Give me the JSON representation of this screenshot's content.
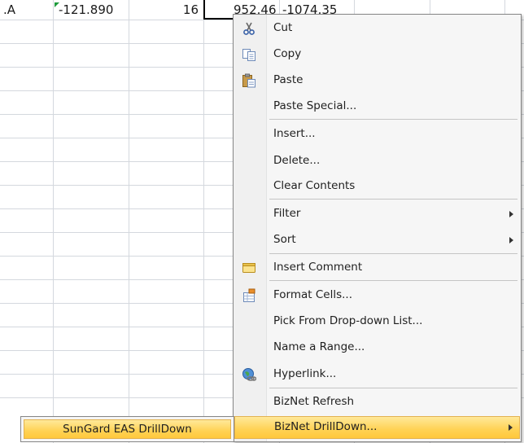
{
  "sheet": {
    "cells": {
      "a_partial": ".A",
      "b": "-121.890",
      "c": "16",
      "d": "952.46",
      "e": "-1074.35"
    }
  },
  "context_menu": {
    "items": [
      {
        "label": "Cut",
        "icon": "scissors-icon"
      },
      {
        "label": "Copy",
        "icon": "copy-icon"
      },
      {
        "label": "Paste",
        "icon": "clipboard-paste-icon"
      },
      {
        "label": "Paste Special..."
      },
      {
        "label": "Insert..."
      },
      {
        "label": "Delete..."
      },
      {
        "label": "Clear Contents"
      },
      {
        "label": "Filter",
        "submenu": true
      },
      {
        "label": "Sort",
        "submenu": true
      },
      {
        "label": "Insert Comment",
        "icon": "comment-icon"
      },
      {
        "label": "Format Cells...",
        "icon": "format-cells-icon"
      },
      {
        "label": "Pick From Drop-down List..."
      },
      {
        "label": "Name a Range..."
      },
      {
        "label": "Hyperlink...",
        "icon": "hyperlink-globe-icon"
      },
      {
        "label": "BizNet Refresh"
      },
      {
        "label": "BizNet DrillDown...",
        "submenu": true,
        "highlighted": true
      }
    ]
  },
  "submenu": {
    "item": "SunGard EAS DrillDown"
  },
  "colors": {
    "highlight": "#ffd254",
    "highlight_border": "#e3b24f",
    "grid_line": "#d4d8de",
    "error_indicator": "#1e9b3c"
  }
}
